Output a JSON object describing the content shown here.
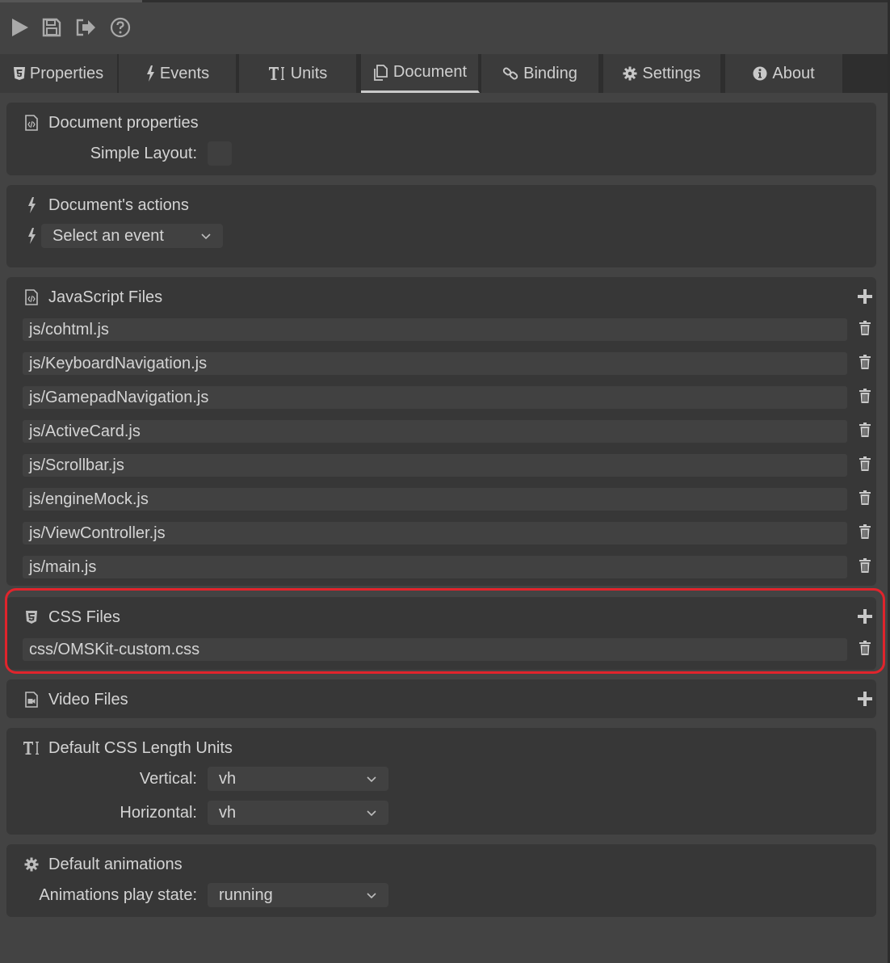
{
  "tabs": [
    {
      "label": "Properties",
      "icon": "html5-icon"
    },
    {
      "label": "Events",
      "icon": "bolt-icon"
    },
    {
      "label": "Units",
      "icon": "text-size-icon"
    },
    {
      "label": "Document",
      "icon": "documents-icon"
    },
    {
      "label": "Binding",
      "icon": "link-icon"
    },
    {
      "label": "Settings",
      "icon": "gear-icon"
    },
    {
      "label": "About",
      "icon": "info-icon"
    }
  ],
  "active_tab": "Document",
  "document_properties": {
    "title": "Document properties",
    "simple_layout_label": "Simple Layout:",
    "simple_layout_checked": false
  },
  "actions": {
    "title": "Document's actions",
    "select_placeholder": "Select an event"
  },
  "js_files": {
    "title": "JavaScript Files",
    "items": [
      "js/cohtml.js",
      "js/KeyboardNavigation.js",
      "js/GamepadNavigation.js",
      "js/ActiveCard.js",
      "js/Scrollbar.js",
      "js/engineMock.js",
      "js/ViewController.js",
      "js/main.js"
    ]
  },
  "css_files": {
    "title": "CSS Files",
    "items": [
      "css/OMSKit-custom.css"
    ]
  },
  "video_files": {
    "title": "Video Files"
  },
  "units": {
    "title": "Default CSS Length Units",
    "vertical_label": "Vertical:",
    "vertical_value": "vh",
    "horizontal_label": "Horizontal:",
    "horizontal_value": "vh"
  },
  "animations": {
    "title": "Default animations",
    "play_state_label": "Animations play state:",
    "play_state_value": "running"
  },
  "colors": {
    "highlight": "#e0242c",
    "background": "#434343",
    "panel": "#373737"
  }
}
